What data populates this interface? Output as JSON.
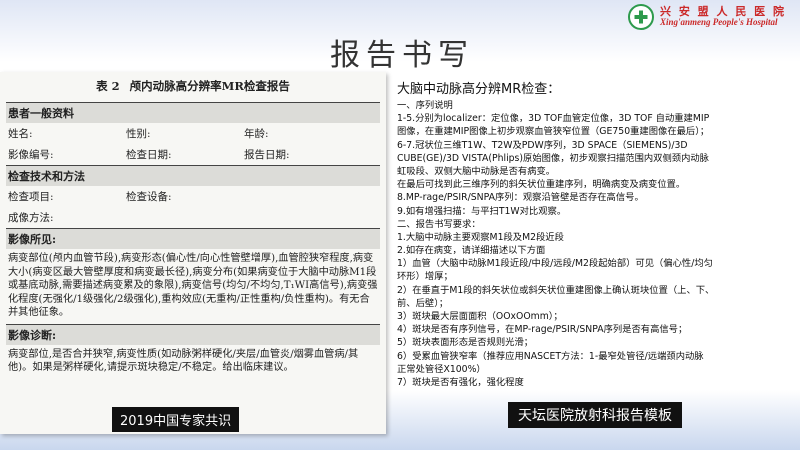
{
  "logo": {
    "name_cn": "兴 安 盟 人 民 医 院",
    "name_en": "Xing'anmeng People's Hospital"
  },
  "slide_title": "报告书写",
  "scan": {
    "table_no": "表 2",
    "table_title": "颅内动脉高分辨率MR检查报告",
    "sec_patient": "患者一般资料",
    "patient_row1": [
      "姓名:",
      "性别:",
      "年龄:"
    ],
    "patient_row2": [
      "影像编号:",
      "检查日期:",
      "报告日期:"
    ],
    "sec_tech": "检查技术和方法",
    "tech_row1": [
      "检查项目:",
      "检查设备:"
    ],
    "tech_row2": "成像方法:",
    "sec_findings": "影像所见:",
    "findings": "病变部位(颅内血管节段),病变形态(偏心性/向心性管壁增厚),血管腔狭窄程度,病变大小(病变区最大管壁厚度和病变最长径),病变分布(如果病变位于大脑中动脉M1段或基底动脉,需要描述病变累及的象限),病变信号(均匀/不均匀,T₁WI高信号),病变强化程度(无强化/1级强化/2级强化),重构效应(无重构/正性重构/负性重构)。有无合并其他征象。",
    "sec_diagnosis": "影像诊断:",
    "diagnosis": "病变部位,是否合并狭窄,病变性质(如动脉粥样硬化/夹层/血管炎/烟雾血管病/其他)。如果是粥样硬化,请提示斑块稳定/不稳定。给出临床建议。"
  },
  "tag_left": "2019中国专家共识",
  "right": {
    "title": "大脑中动脉高分辨MR检查：",
    "lines": [
      "一、序列说明",
      "1-5.分别为localizer：定位像，3D TOF血管定位像，3D TOF 自动重建MIP",
      "图像，在重建MIP图像上初步观察血管狭窄位置（GE750重建图像在最后）；",
      "6-7.冠状位三维T1W、T2W及PDW序列，3D SPACE（SIEMENS)/3D",
      "CUBE(GE)/3D VISTA(Phlips)原始图像，初步观察扫描范围内双侧颈内动脉",
      "虹吸段、双侧大脑中动脉是否有病变。",
      "在最后可找到此三维序列的斜矢状位重建序列，明确病变及病变位置。",
      "8.MP-rage/PSIR/SNPA序列：观察沿管壁是否存在高信号。",
      "9.如有增强扫描：与平扫T1W对比观察。",
      "二、报告书写要求：",
      "1.大脑中动脉主要观察M1段及M2段近段",
      "2.如存在病变，请详细描述以下方面",
      "1）血管（大脑中动脉M1段近段/中段/远段/M2段起始部）可见（偏心性/均匀",
      "环形）增厚；",
      "2）在垂直于M1段的斜矢状位或斜矢状位重建图像上确认斑块位置（上、下、",
      "前、后壁）；",
      "3）斑块最大层面面积（OOxOOmm）；",
      "4）斑块是否有序列信号，在MP-rage/PSIR/SNPA序列是否有高信号；",
      "5）斑块表面形态是否规则光滑；",
      "6）受累血管狭窄率（推荐应用NASCET方法：1-最窄处管径/远端颈内动脉",
      "正常处管径X100%）",
      "7）斑块是否有强化，强化程度"
    ]
  },
  "tag_right": "天坛医院放射科报告模板"
}
